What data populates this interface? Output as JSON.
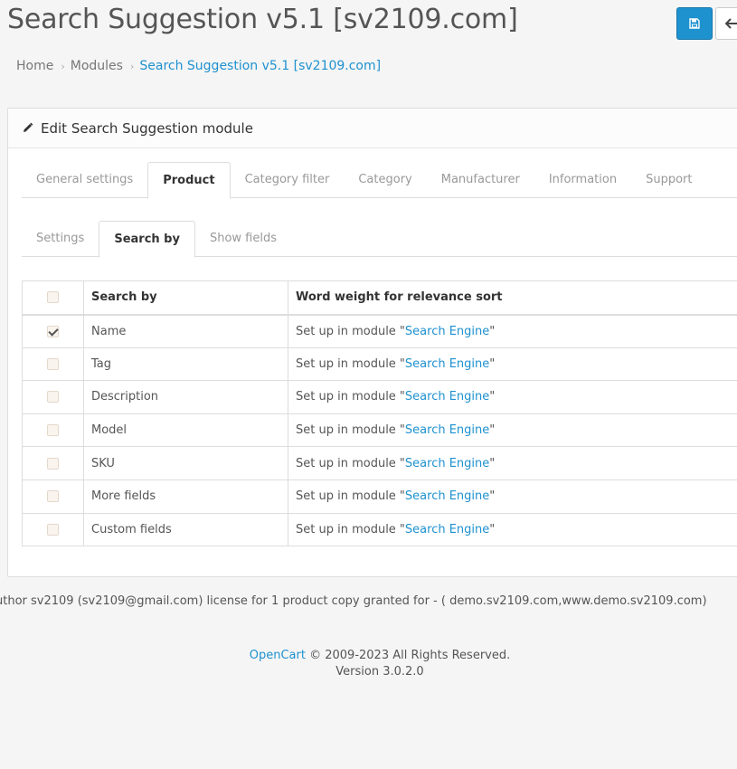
{
  "header": {
    "title": "Search Suggestion v5.1 [sv2109.com]",
    "save_icon": "save-icon",
    "back_icon": "arrow-left-icon"
  },
  "breadcrumb": [
    "Home",
    "Modules",
    "Search Suggestion v5.1 [sv2109.com]"
  ],
  "panel": {
    "title": "Edit Search Suggestion module",
    "icon": "pencil-icon"
  },
  "tabs": [
    {
      "label": "General settings",
      "active": false
    },
    {
      "label": "Product",
      "active": true
    },
    {
      "label": "Category filter",
      "active": false
    },
    {
      "label": "Category",
      "active": false
    },
    {
      "label": "Manufacturer",
      "active": false
    },
    {
      "label": "Information",
      "active": false
    },
    {
      "label": "Support",
      "active": false
    }
  ],
  "subtabs": [
    {
      "label": "Settings",
      "active": false
    },
    {
      "label": "Search by",
      "active": true
    },
    {
      "label": "Show fields",
      "active": false
    }
  ],
  "table": {
    "headers": [
      "",
      "Search by",
      "Word weight for relevance sort"
    ],
    "rows": [
      {
        "checked": true,
        "field": "Name",
        "text": "Set up in module \"",
        "link": "Search Engine",
        "suffix": "\""
      },
      {
        "checked": false,
        "field": "Tag",
        "text": "Set up in module \"",
        "link": "Search Engine",
        "suffix": "\""
      },
      {
        "checked": false,
        "field": "Description",
        "text": "Set up in module \"",
        "link": "Search Engine",
        "suffix": "\""
      },
      {
        "checked": false,
        "field": "Model",
        "text": "Set up in module \"",
        "link": "Search Engine",
        "suffix": "\""
      },
      {
        "checked": false,
        "field": "SKU",
        "text": "Set up in module \"",
        "link": "Search Engine",
        "suffix": "\""
      },
      {
        "checked": false,
        "field": "More fields",
        "text": "Set up in module \"",
        "link": "Search Engine",
        "suffix": "\""
      },
      {
        "checked": false,
        "field": "Custom fields",
        "text": "Set up in module \"",
        "link": "Search Engine",
        "suffix": "\""
      }
    ]
  },
  "license": "uthor sv2109 (sv2109@gmail.com) license for 1 product copy granted for - ( demo.sv2109.com,www.demo.sv2109.com)",
  "footer": {
    "brand": "OpenCart",
    "copyright": " © 2009-2023 All Rights Reserved.",
    "version": "Version 3.0.2.0"
  },
  "colors": {
    "accent": "#1e91cf",
    "background": "#f5f5f5"
  }
}
